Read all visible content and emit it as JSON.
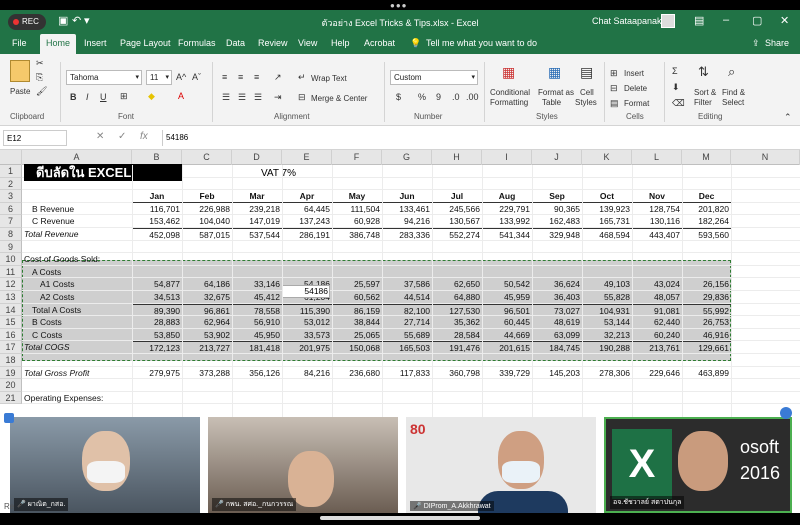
{
  "window": {
    "rec_label": "REC",
    "title": "ตัวอย่าง Excel Tricks & Tips.xlsx  -  Excel",
    "user_name": "Chat Sataapanakul",
    "share_label": "Share"
  },
  "ribbon_tabs": [
    "File",
    "Home",
    "Insert",
    "Page Layout",
    "Formulas",
    "Data",
    "Review",
    "View",
    "Help",
    "Acrobat"
  ],
  "tell_me": "Tell me what you want to do",
  "ribbon": {
    "clipboard": {
      "label": "Clipboard",
      "paste": "Paste"
    },
    "font": {
      "label": "Font",
      "font_name": "Tahoma",
      "font_size": "11",
      "bold": "B",
      "italic": "I",
      "underline": "U"
    },
    "alignment": {
      "label": "Alignment",
      "wrap": "Wrap Text",
      "merge": "Merge & Center"
    },
    "number": {
      "label": "Number",
      "format": "Custom",
      "currency": "$",
      "percent": "%",
      "comma": "9"
    },
    "styles": {
      "label": "Styles",
      "cond_1": "Conditional",
      "cond_2": "Formatting",
      "table_1": "Format as",
      "table_2": "Table",
      "cell_1": "Cell",
      "cell_2": "Styles"
    },
    "cells": {
      "label": "Cells",
      "insert": "Insert",
      "delete": "Delete",
      "format": "Format"
    },
    "editing": {
      "label": "Editing",
      "sort_1": "Sort &",
      "sort_2": "Filter",
      "find_1": "Find &",
      "find_2": "Select"
    }
  },
  "formula_bar": {
    "name_box": "E12",
    "cancel": "✕",
    "enter": "✓",
    "fx": "fx",
    "value": "54186"
  },
  "columns": [
    "A",
    "B",
    "C",
    "D",
    "E",
    "F",
    "G",
    "H",
    "I",
    "J",
    "K",
    "L",
    "M",
    "N"
  ],
  "sheet": {
    "logo_text": "ดีบลัดใน EXCEL",
    "vat": "VAT 7%",
    "months": [
      "Jan",
      "Feb",
      "Mar",
      "Apr",
      "May",
      "Jun",
      "Jul",
      "Aug",
      "Sep",
      "Oct",
      "Nov",
      "Dec"
    ],
    "rows": [
      {
        "n": "1",
        "label": "",
        "vals": []
      },
      {
        "n": "2",
        "label": "",
        "vals": []
      },
      {
        "n": "3",
        "label": "",
        "vals": [],
        "months": true
      },
      {
        "n": "6",
        "label": "B Revenue",
        "indent": 2,
        "vals": [
          "116,701",
          "226,988",
          "239,218",
          "64,445",
          "111,504",
          "133,461",
          "245,566",
          "229,791",
          "90,365",
          "139,923",
          "128,754",
          "201,820"
        ]
      },
      {
        "n": "7",
        "label": "C Revenue",
        "indent": 2,
        "vals": [
          "153,462",
          "104,040",
          "147,019",
          "137,243",
          "60,928",
          "94,216",
          "130,567",
          "133,992",
          "162,483",
          "165,731",
          "130,116",
          "182,264"
        ]
      },
      {
        "n": "8",
        "label": "Total Revenue",
        "italic": true,
        "vals": [
          "452,098",
          "587,015",
          "537,544",
          "286,191",
          "386,748",
          "283,336",
          "552,274",
          "541,344",
          "329,948",
          "468,594",
          "443,407",
          "593,560"
        ]
      },
      {
        "n": "9",
        "label": "",
        "vals": []
      },
      {
        "n": "10",
        "label": "Cost of Goods Sold:",
        "vals": []
      },
      {
        "n": "11",
        "label": "A Costs",
        "indent": 2,
        "vals": []
      },
      {
        "n": "12",
        "label": "A1 Costs",
        "indent": 4,
        "vals": [
          "54,877",
          "64,186",
          "33,146",
          "54,186",
          "25,597",
          "37,586",
          "62,650",
          "50,542",
          "36,624",
          "49,103",
          "43,024",
          "26,156"
        ]
      },
      {
        "n": "13",
        "label": "A2 Costs",
        "indent": 4,
        "vals": [
          "34,513",
          "32,675",
          "45,412",
          "61,204",
          "60,562",
          "44,514",
          "64,880",
          "45,959",
          "36,403",
          "55,828",
          "48,057",
          "29,836"
        ]
      },
      {
        "n": "14",
        "label": "Total A Costs",
        "indent": 2,
        "vals": [
          "89,390",
          "96,861",
          "78,558",
          "115,390",
          "86,159",
          "82,100",
          "127,530",
          "96,501",
          "73,027",
          "104,931",
          "91,081",
          "55,992"
        ]
      },
      {
        "n": "15",
        "label": "B Costs",
        "indent": 2,
        "vals": [
          "28,883",
          "62,964",
          "56,910",
          "53,012",
          "38,844",
          "27,714",
          "35,362",
          "60,445",
          "48,619",
          "53,144",
          "62,440",
          "26,753"
        ]
      },
      {
        "n": "16",
        "label": "C Costs",
        "indent": 2,
        "vals": [
          "53,850",
          "53,902",
          "45,950",
          "33,573",
          "25,065",
          "55,689",
          "28,584",
          "44,669",
          "63,099",
          "32,213",
          "60,240",
          "46,916"
        ]
      },
      {
        "n": "17",
        "label": "Total COGS",
        "italic": true,
        "vals": [
          "172,123",
          "213,727",
          "181,418",
          "201,975",
          "150,068",
          "165,503",
          "191,476",
          "201,615",
          "184,745",
          "190,288",
          "213,761",
          "129,661"
        ]
      },
      {
        "n": "18",
        "label": "",
        "vals": []
      },
      {
        "n": "19",
        "label": "Total Gross Profit",
        "italic": true,
        "vals": [
          "279,975",
          "373,288",
          "356,126",
          "84,216",
          "236,680",
          "117,833",
          "360,798",
          "339,729",
          "145,203",
          "278,306",
          "229,646",
          "463,899"
        ]
      },
      {
        "n": "20",
        "label": "",
        "vals": []
      },
      {
        "n": "21",
        "label": "Operating Expenses:",
        "vals": []
      }
    ]
  },
  "participants": [
    {
      "name": "ผาณิต_กสอ."
    },
    {
      "name": "กพน. สศอ._กนกวรรณ"
    },
    {
      "name": "DIProm_A.Akkhrawat"
    },
    {
      "name": "อจ.ชัชวาลย์ สตาปนกุล",
      "backdrop_1": "osoft",
      "backdrop_2": "2016"
    }
  ],
  "status_peek": "Re"
}
